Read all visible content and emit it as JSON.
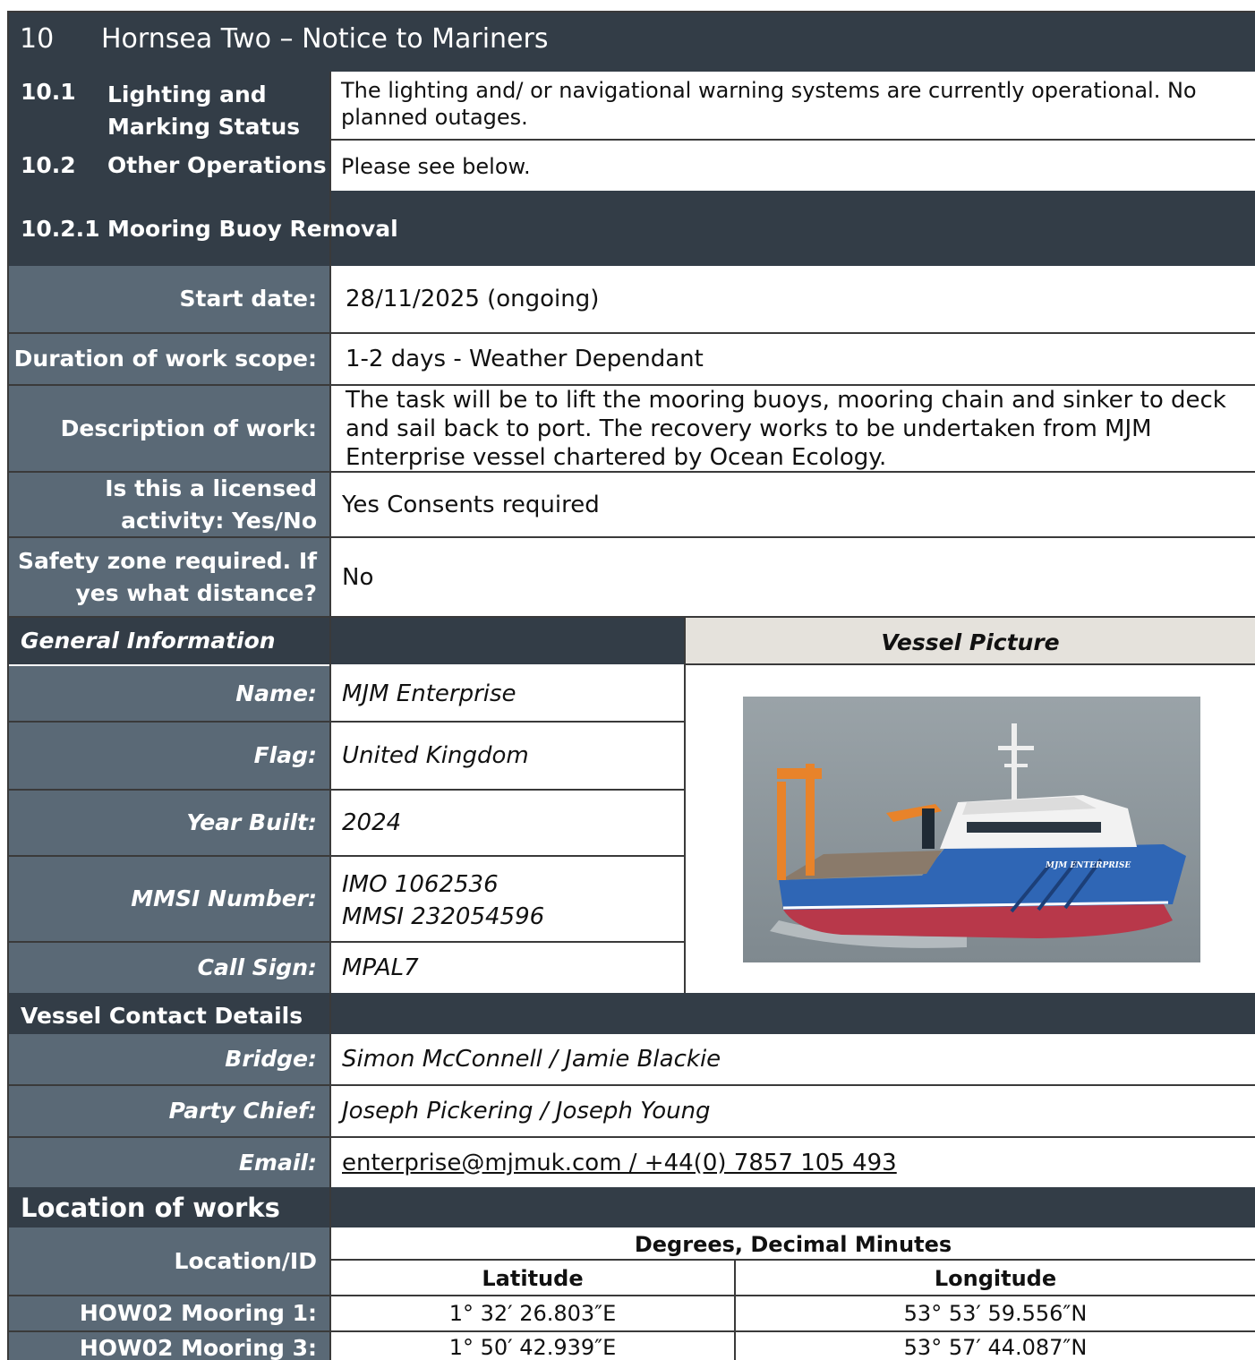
{
  "header": {
    "number": "10",
    "title": "Hornsea Two – Notice to Mariners"
  },
  "status": [
    {
      "num": "10.1",
      "label": "Lighting and Marking Status",
      "value": "The lighting and/ or navigational warning systems are currently operational. No planned outages."
    },
    {
      "num": "10.2",
      "label": "Other Operations",
      "value": "Please see below."
    }
  ],
  "operation": {
    "num": "10.2.1",
    "title": "Mooring Buoy Removal"
  },
  "work": {
    "start_label": "Start date:",
    "start_value": "28/11/2025 (ongoing)",
    "duration_label": "Duration of work scope:",
    "duration_value": "1-2 days - Weather Dependant",
    "description_label": "Description of work:",
    "description_value": "The task will be to lift the mooring buoys, mooring chain and sinker to deck and sail back to port. The recovery works to be undertaken from MJM Enterprise vessel chartered by Ocean Ecology.",
    "licensed_label": "Is this a licensed activity: Yes/No",
    "licensed_value": "Yes Consents required",
    "safety_label": "Safety zone required. If yes what distance?",
    "safety_value": "No"
  },
  "general": {
    "title": "General Information",
    "picture_title": "Vessel Picture",
    "name_label": "Name:",
    "name_value": "MJM Enterprise",
    "flag_label": "Flag:",
    "flag_value": "United Kingdom",
    "year_label": "Year Built:",
    "year_value": "2024",
    "mmsi_label": "MMSI Number:",
    "imo_value": "IMO 1062536",
    "mmsi_value": "MMSI 232054596",
    "call_label": "Call Sign:",
    "call_value": "MPAL7",
    "vessel_name_on_hull": "MJM ENTERPRISE"
  },
  "contact": {
    "title": "Vessel Contact Details",
    "bridge_label": "Bridge:",
    "bridge_value": "Simon McConnell / Jamie Blackie",
    "chief_label": "Party Chief:",
    "chief_value": "Joseph Pickering / Joseph Young",
    "email_label": "Email:",
    "email_value": "enterprise@mjmuk.com / +44(0) 7857 105 493"
  },
  "location": {
    "title": "Location of works",
    "id_header": "Location/ID",
    "coord_header": "Degrees, Decimal Minutes",
    "lat_header": "Latitude",
    "lon_header": "Longitude",
    "rows": [
      {
        "id": "HOW02 Mooring 1:",
        "lat": "1° 32′ 26.803″E",
        "lon": "53° 53′ 59.556″N"
      },
      {
        "id": "HOW02 Mooring 3:",
        "lat": "1° 50′ 42.939″E",
        "lon": "53° 57′ 44.087″N"
      }
    ]
  },
  "colors": {
    "dark": "#333d47",
    "slate": "#5a6976",
    "picture_header": "#e5e2dc",
    "hull_blue": "#2f66b5",
    "hull_red": "#b8384a",
    "crane_orange": "#e8832a"
  }
}
